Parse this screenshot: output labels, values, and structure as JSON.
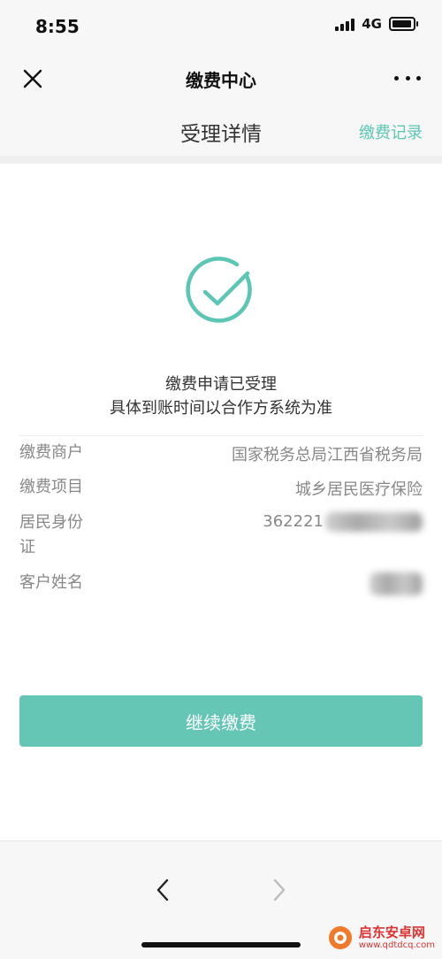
{
  "status_bar": {
    "time": "8:55",
    "network": "4G"
  },
  "nav": {
    "title": "缴费中心"
  },
  "subheader": {
    "title": "受理详情",
    "record_link": "缴费记录"
  },
  "result": {
    "line1": "缴费申请已受理",
    "line2": "具体到账时间以合作方系统为准"
  },
  "details": [
    {
      "label": "缴费商户",
      "value": "国家税务总局江西省税务局"
    },
    {
      "label": "缴费项目",
      "value": "城乡居民医疗保险"
    },
    {
      "label": "居民身份证",
      "value": "362221"
    },
    {
      "label": "客户姓名",
      "value": ""
    }
  ],
  "actions": {
    "continue_label": "继续缴费"
  },
  "watermark": {
    "title": "启东安卓网",
    "url": "www.qdtdcq.com"
  },
  "colors": {
    "accent": "#5cc6b5",
    "button": "#65c6b6"
  }
}
